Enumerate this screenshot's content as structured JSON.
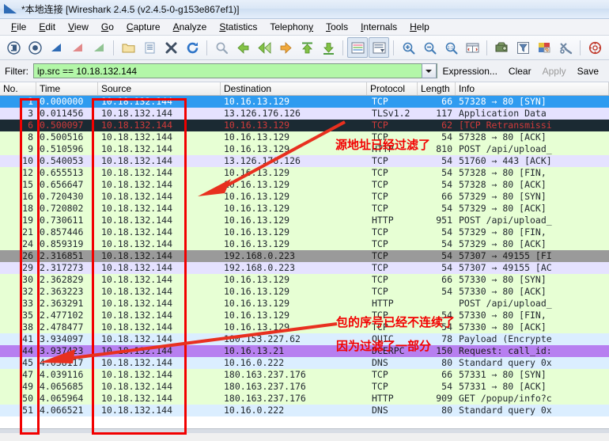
{
  "window": {
    "title": "*本地连接  [Wireshark 2.4.5 (v2.4.5-0-g153e867ef1)]",
    "app_icon": "wireshark-fin-icon"
  },
  "menubar": {
    "items": [
      {
        "label": "File"
      },
      {
        "label": "Edit"
      },
      {
        "label": "View"
      },
      {
        "label": "Go"
      },
      {
        "label": "Capture"
      },
      {
        "label": "Analyze"
      },
      {
        "label": "Statistics"
      },
      {
        "label": "Telephony"
      },
      {
        "label": "Tools"
      },
      {
        "label": "Internals"
      },
      {
        "label": "Help"
      }
    ]
  },
  "toolbar": {
    "buttons": [
      {
        "name": "list-interfaces-icon",
        "glyph": "◉"
      },
      {
        "name": "start-capture-icon",
        "glyph": "◎"
      },
      {
        "name": "stop-capture-icon",
        "glyph": "◢"
      },
      {
        "name": "restart-capture-icon",
        "glyph": "▩"
      },
      {
        "name": "capture-options-icon",
        "glyph": "◣"
      },
      {
        "name": "open-file-icon",
        "glyph": "🗁"
      },
      {
        "name": "save-file-icon",
        "glyph": "🗋"
      },
      {
        "name": "close-file-icon",
        "glyph": "✖"
      },
      {
        "name": "reload-file-icon",
        "glyph": "⟳"
      },
      {
        "name": "find-packet-icon",
        "glyph": "🔍"
      },
      {
        "name": "go-back-icon",
        "glyph": "⬅"
      },
      {
        "name": "go-forward-icon",
        "glyph": "➡"
      },
      {
        "name": "go-to-packet-icon",
        "glyph": "➠"
      },
      {
        "name": "go-to-first-packet-icon",
        "glyph": "⇧"
      },
      {
        "name": "go-to-last-packet-icon",
        "glyph": "⇩"
      },
      {
        "name": "colorize-packet-list-icon",
        "glyph": "▤"
      },
      {
        "name": "auto-scroll-icon",
        "glyph": "▤"
      },
      {
        "name": "zoom-in-icon",
        "glyph": "⊕"
      },
      {
        "name": "zoom-out-icon",
        "glyph": "⊖"
      },
      {
        "name": "zoom-reset-icon",
        "glyph": "⊙"
      },
      {
        "name": "resize-columns-icon",
        "glyph": "▥"
      },
      {
        "name": "capture-filters-icon",
        "glyph": "⛋"
      },
      {
        "name": "display-filters-icon",
        "glyph": "▽"
      },
      {
        "name": "coloring-rules-icon",
        "glyph": "▧"
      },
      {
        "name": "preferences-icon",
        "glyph": "✂"
      },
      {
        "name": "help-contents-icon",
        "glyph": "✪"
      }
    ]
  },
  "filterbar": {
    "label": "Filter:",
    "value": "ip.src == 10.18.132.144",
    "placeholder": "",
    "expression_label": "Expression...",
    "clear_label": "Clear",
    "apply_label": "Apply",
    "save_label": "Save",
    "field_bg": "#b3f7a8"
  },
  "packet_list": {
    "columns": [
      {
        "key": "no",
        "label": "No."
      },
      {
        "key": "time",
        "label": "Time"
      },
      {
        "key": "source",
        "label": "Source"
      },
      {
        "key": "destination",
        "label": "Destination"
      },
      {
        "key": "protocol",
        "label": "Protocol"
      },
      {
        "key": "length",
        "label": "Length"
      },
      {
        "key": "info",
        "label": "Info"
      }
    ],
    "rows": [
      {
        "no": "1",
        "time": "0.000000",
        "source": "10.18.132.144",
        "destination": "10.16.13.129",
        "protocol": "TCP",
        "length": "66",
        "info": "57328 → 80 [SYN]",
        "style": "selected"
      },
      {
        "no": "3",
        "time": "0.011456",
        "source": "10.18.132.144",
        "destination": "13.126.176.126",
        "protocol": "TLSv1.2",
        "length": "117",
        "info": "Application Data",
        "style": "tls"
      },
      {
        "no": "6",
        "time": "0.500097",
        "source": "10.18.132.144",
        "destination": "10.16.13.129",
        "protocol": "TCP",
        "length": "62",
        "info": "[TCP Retransmissi",
        "style": "bad"
      },
      {
        "no": "8",
        "time": "0.500516",
        "source": "10.18.132.144",
        "destination": "10.16.13.129",
        "protocol": "TCP",
        "length": "54",
        "info": "57328 → 80 [ACK]",
        "style": "tcp"
      },
      {
        "no": "9",
        "time": "0.510596",
        "source": "10.18.132.144",
        "destination": "10.16.13.129",
        "protocol": "HTTP",
        "length": "810",
        "info": "POST /api/upload_",
        "style": "tcp"
      },
      {
        "no": "10",
        "time": "0.540053",
        "source": "10.18.132.144",
        "destination": "13.126.176.126",
        "protocol": "TCP",
        "length": "54",
        "info": "51760 → 443 [ACK]",
        "style": "tls"
      },
      {
        "no": "12",
        "time": "0.655513",
        "source": "10.18.132.144",
        "destination": "10.16.13.129",
        "protocol": "TCP",
        "length": "54",
        "info": "57328 → 80 [FIN,",
        "style": "tcp"
      },
      {
        "no": "15",
        "time": "0.656647",
        "source": "10.18.132.144",
        "destination": "10.16.13.129",
        "protocol": "TCP",
        "length": "54",
        "info": "57328 → 80 [ACK]",
        "style": "tcp"
      },
      {
        "no": "16",
        "time": "0.720430",
        "source": "10.18.132.144",
        "destination": "10.16.13.129",
        "protocol": "TCP",
        "length": "66",
        "info": "57329 → 80 [SYN]",
        "style": "tcp"
      },
      {
        "no": "18",
        "time": "0.720802",
        "source": "10.18.132.144",
        "destination": "10.16.13.129",
        "protocol": "TCP",
        "length": "54",
        "info": "57329 → 80 [ACK]",
        "style": "tcp"
      },
      {
        "no": "19",
        "time": "0.730611",
        "source": "10.18.132.144",
        "destination": "10.16.13.129",
        "protocol": "HTTP",
        "length": "951",
        "info": "POST /api/upload_",
        "style": "tcp"
      },
      {
        "no": "21",
        "time": "0.857446",
        "source": "10.18.132.144",
        "destination": "10.16.13.129",
        "protocol": "TCP",
        "length": "54",
        "info": "57329 → 80 [FIN,",
        "style": "tcp"
      },
      {
        "no": "24",
        "time": "0.859319",
        "source": "10.18.132.144",
        "destination": "10.16.13.129",
        "protocol": "TCP",
        "length": "54",
        "info": "57329 → 80 [ACK]",
        "style": "tcp"
      },
      {
        "no": "26",
        "time": "2.316851",
        "source": "10.18.132.144",
        "destination": "192.168.0.223",
        "protocol": "TCP",
        "length": "54",
        "info": "57307 → 49155 [FI",
        "style": "gray"
      },
      {
        "no": "29",
        "time": "2.317273",
        "source": "10.18.132.144",
        "destination": "192.168.0.223",
        "protocol": "TCP",
        "length": "54",
        "info": "57307 → 49155 [AC",
        "style": "tls"
      },
      {
        "no": "30",
        "time": "2.362829",
        "source": "10.18.132.144",
        "destination": "10.16.13.129",
        "protocol": "TCP",
        "length": "66",
        "info": "57330 → 80 [SYN]",
        "style": "tcp"
      },
      {
        "no": "32",
        "time": "2.363223",
        "source": "10.18.132.144",
        "destination": "10.16.13.129",
        "protocol": "TCP",
        "length": "54",
        "info": "57330 → 80 [ACK]",
        "style": "tcp"
      },
      {
        "no": "33",
        "time": "2.363291",
        "source": "10.18.132.144",
        "destination": "10.16.13.129",
        "protocol": "HTTP",
        "length": "",
        "info": "POST /api/upload_",
        "style": "tcp"
      },
      {
        "no": "35",
        "time": "2.477102",
        "source": "10.18.132.144",
        "destination": "10.16.13.129",
        "protocol": "TCP",
        "length": "54",
        "info": "57330 → 80 [FIN,",
        "style": "tcp"
      },
      {
        "no": "38",
        "time": "2.478477",
        "source": "10.18.132.144",
        "destination": "10.16.13.129",
        "protocol": "TCP",
        "length": "54",
        "info": "57330 → 80 [ACK]",
        "style": "tcp"
      },
      {
        "no": "41",
        "time": "3.934097",
        "source": "10.18.132.144",
        "destination": "180.153.227.62",
        "protocol": "QUIC",
        "length": "78",
        "info": "Payload (Encrypte",
        "style": "udp"
      },
      {
        "no": "44",
        "time": "3.937423",
        "source": "10.18.132.144",
        "destination": "10.16.13.21",
        "protocol": "DCERPC",
        "length": "150",
        "info": "Request: call_id:",
        "style": "purple"
      },
      {
        "no": "45",
        "time": "4.038117",
        "source": "10.18.132.144",
        "destination": "10.16.0.222",
        "protocol": "DNS",
        "length": "80",
        "info": "Standard query 0x",
        "style": "udp"
      },
      {
        "no": "47",
        "time": "4.039116",
        "source": "10.18.132.144",
        "destination": "180.163.237.176",
        "protocol": "TCP",
        "length": "66",
        "info": "57331 → 80 [SYN]",
        "style": "tcp"
      },
      {
        "no": "49",
        "time": "4.065685",
        "source": "10.18.132.144",
        "destination": "180.163.237.176",
        "protocol": "TCP",
        "length": "54",
        "info": "57331 → 80 [ACK]",
        "style": "tcp"
      },
      {
        "no": "50",
        "time": "4.065964",
        "source": "10.18.132.144",
        "destination": "180.163.237.176",
        "protocol": "HTTP",
        "length": "909",
        "info": "GET /popup/info?c",
        "style": "tcp"
      },
      {
        "no": "51",
        "time": "4.066521",
        "source": "10.18.132.144",
        "destination": "10.16.0.222",
        "protocol": "DNS",
        "length": "80",
        "info": "Standard query 0x",
        "style": "udp"
      }
    ]
  },
  "annotations": {
    "color": "#f20000",
    "notes": [
      {
        "id": "source-filtered-note",
        "text": "源地址已经过滤了"
      },
      {
        "id": "sequence-discontinuous-note-line1",
        "text": "包的序号已经不连续了"
      },
      {
        "id": "sequence-discontinuous-note-line2",
        "text": "因为过滤了一部分"
      }
    ],
    "highlight_boxes": [
      {
        "id": "no-column-highlight"
      },
      {
        "id": "source-column-highlight"
      }
    ],
    "arrows": [
      {
        "id": "arrow-to-source-column"
      },
      {
        "id": "arrow-to-no-column"
      }
    ]
  }
}
